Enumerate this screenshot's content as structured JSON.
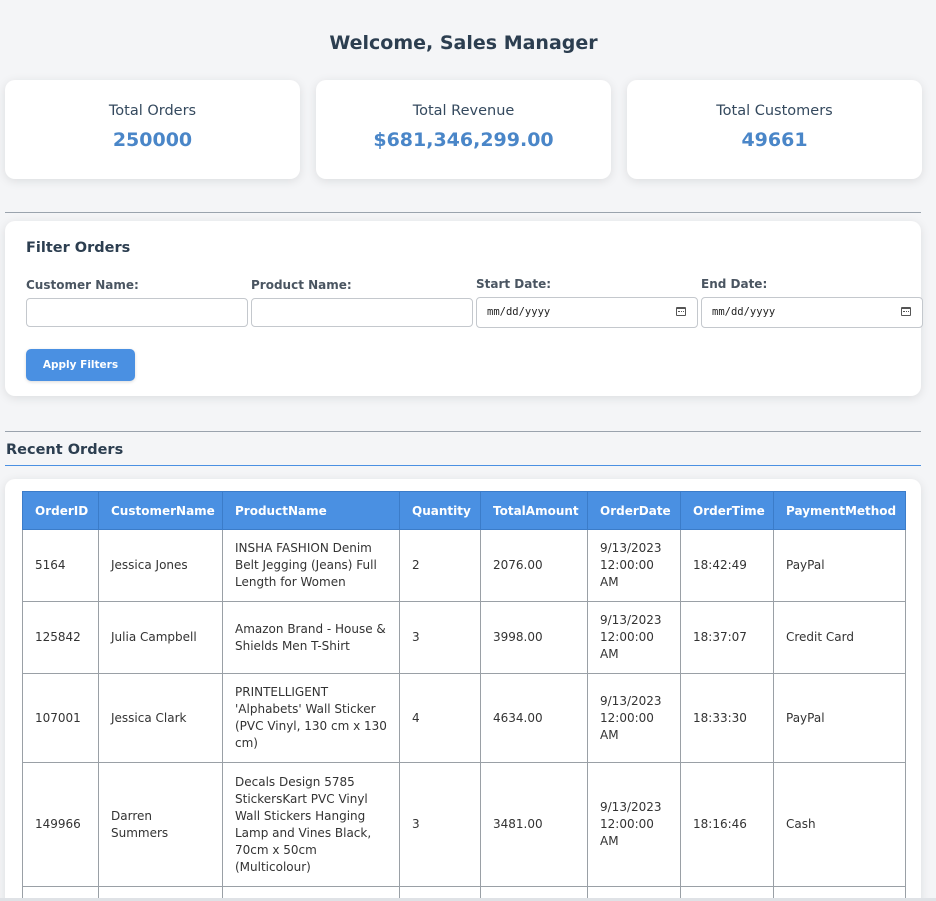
{
  "header": {
    "welcome": "Welcome, Sales Manager"
  },
  "stats": [
    {
      "label": "Total Orders",
      "value": "250000"
    },
    {
      "label": "Total Revenue",
      "value": "$681,346,299.00"
    },
    {
      "label": "Total Customers",
      "value": "49661"
    }
  ],
  "filters": {
    "title": "Filter Orders",
    "customer_label": "Customer Name:",
    "product_label": "Product Name:",
    "start_label": "Start Date:",
    "end_label": "End Date:",
    "start_placeholder": "mm/dd/yyyy",
    "end_placeholder": "mm/dd/yyyy",
    "apply_label": "Apply Filters"
  },
  "orders": {
    "title": "Recent Orders",
    "columns": [
      "OrderID",
      "CustomerName",
      "ProductName",
      "Quantity",
      "TotalAmount",
      "OrderDate",
      "OrderTime",
      "PaymentMethod"
    ],
    "rows": [
      [
        "5164",
        "Jessica Jones",
        "INSHA FASHION Denim Belt Jegging (Jeans) Full Length for Women",
        "2",
        "2076.00",
        "9/13/2023 12:00:00 AM",
        "18:42:49",
        "PayPal"
      ],
      [
        "125842",
        "Julia Campbell",
        "Amazon Brand - House & Shields Men T-Shirt",
        "3",
        "3998.00",
        "9/13/2023 12:00:00 AM",
        "18:37:07",
        "Credit Card"
      ],
      [
        "107001",
        "Jessica Clark",
        "PRINTELLIGENT 'Alphabets' Wall Sticker (PVC Vinyl, 130 cm x 130 cm)",
        "4",
        "4634.00",
        "9/13/2023 12:00:00 AM",
        "18:33:30",
        "PayPal"
      ],
      [
        "149966",
        "Darren Summers",
        "Decals Design 5785 StickersKart PVC Vinyl Wall Stickers Hanging Lamp and Vines Black, 70cm x 50cm (Multicolour)",
        "3",
        "3481.00",
        "9/13/2023 12:00:00 AM",
        "18:16:46",
        "Cash"
      ],
      [
        "",
        "",
        "",
        "",
        "",
        "",
        "",
        ""
      ]
    ]
  }
}
